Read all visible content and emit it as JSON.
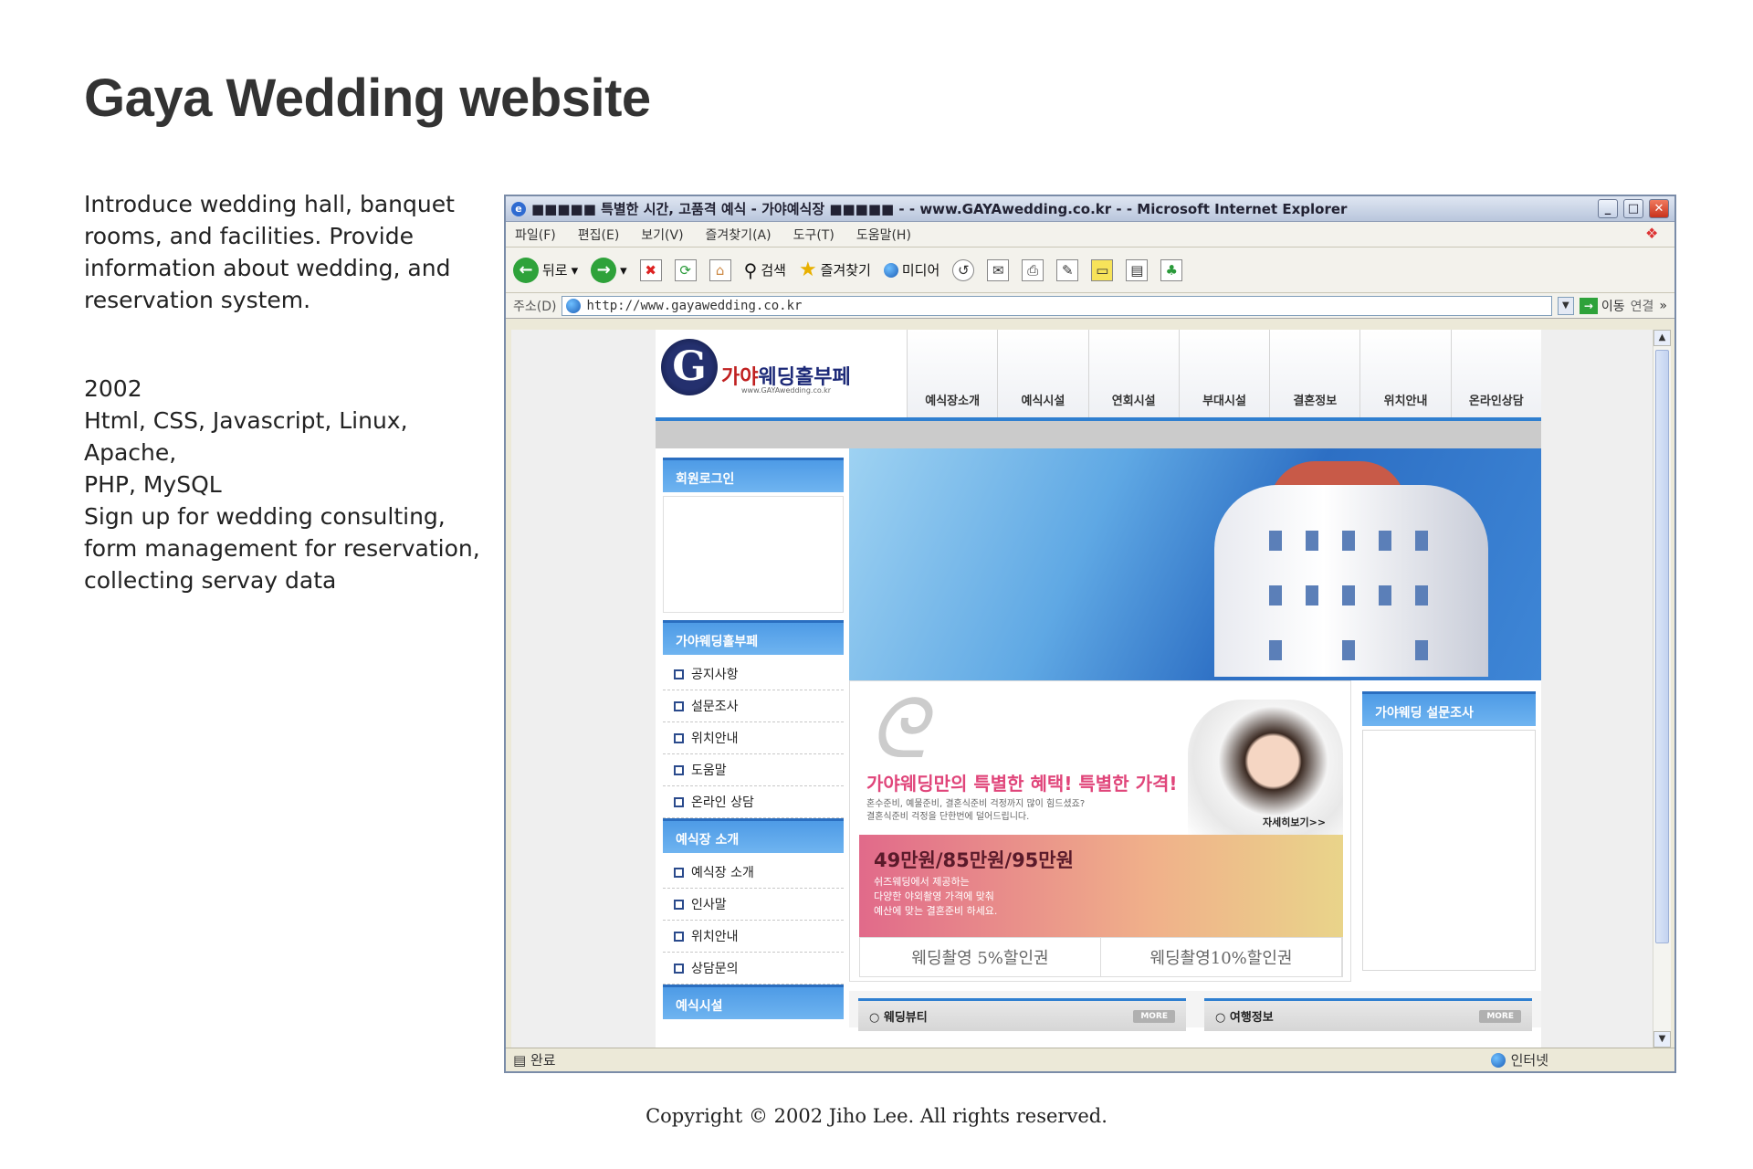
{
  "page": {
    "title": "Gaya Wedding website",
    "description_lines": [
      "Introduce wedding hall, banquet",
      "rooms, and facilities. Provide",
      "information about wedding, and",
      "reservation system."
    ],
    "meta_lines": [
      "2002",
      "Html, CSS, Javascript, Linux, Apache,",
      "PHP, MySQL",
      "Sign up for wedding consulting,",
      "form management for reservation,",
      "collecting servay data"
    ],
    "copyright": "Copyright © 2002 Jiho Lee. All rights reserved."
  },
  "browser": {
    "window_title": "■■■■■ 특별한 시간, 고품격 예식 - 가야예식장 ■■■■■ - - www.GAYAwedding.co.kr - - Microsoft Internet Explorer",
    "menu": [
      "파일(F)",
      "편집(E)",
      "보기(V)",
      "즐겨찾기(A)",
      "도구(T)",
      "도움말(H)"
    ],
    "toolbar": {
      "back": "뒤로",
      "search": "검색",
      "favorites": "즐겨찾기",
      "media": "미디어"
    },
    "address": {
      "label": "주소(D)",
      "url": "http://www.gayawedding.co.kr",
      "go": "이동",
      "links": "연결"
    },
    "status": {
      "left": "완료",
      "zone": "인터넷"
    }
  },
  "site": {
    "logo": {
      "letter": "G",
      "name_a": "가야",
      "name_b": "웨딩홀부페",
      "sub": "www.GAYAwedding.co.kr"
    },
    "nav": [
      "예식장소개",
      "예식시설",
      "연회시설",
      "부대시설",
      "결혼정보",
      "위치안내",
      "온라인상담"
    ],
    "sidebar": {
      "login_title": "회원로그인",
      "section1_title": "가야웨딩홀부페",
      "section1_items": [
        "공지사항",
        "설문조사",
        "위치안내",
        "도움말",
        "온라인 상담"
      ],
      "section2_title": "예식장 소개",
      "section2_items": [
        "예식장 소개",
        "인사말",
        "위치안내",
        "상담문의"
      ],
      "section3_title": "예식시설"
    },
    "promo": {
      "headline": "가야웨딩만의 특별한 혜택! 특별한 가격!",
      "small1": "혼수준비, 예물준비, 결혼식준비 걱정까지 많이 힘드셨죠?",
      "small2": "결혼식준비 걱정을 단한번에 덜어드립니다.",
      "more": "자세히보기>>",
      "price": "49만원/85만원/95만원",
      "price_text1": "쉬즈웨딩에서 제공하는",
      "price_text2": "다양한 야외촬영 가격에 맞춰",
      "price_text3": "예산에 맞는 결혼준비 하세요.",
      "coupon1": "웨딩촬영 5%할인권",
      "coupon2": "웨딩촬영10%할인권"
    },
    "survey_title": "가야웨딩 설문조사",
    "bottom": [
      {
        "label": "웨딩뷰티",
        "more": "MORE"
      },
      {
        "label": "여행정보",
        "more": "MORE"
      }
    ]
  }
}
